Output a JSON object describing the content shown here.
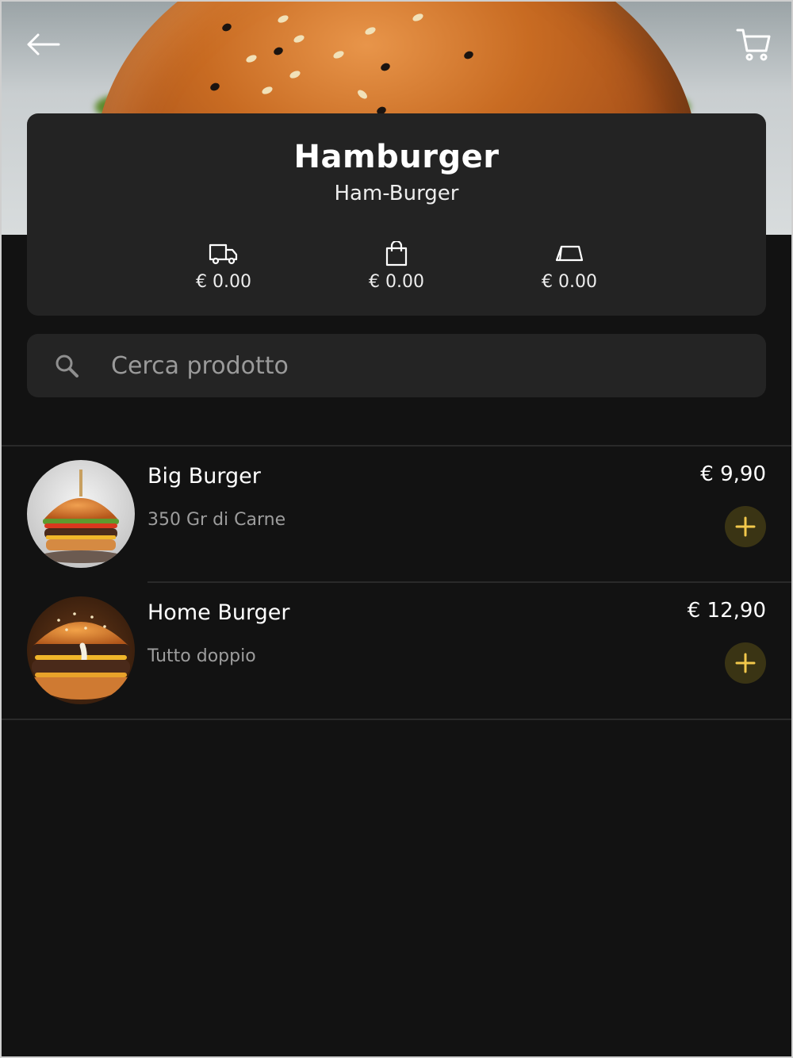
{
  "header": {
    "title": "Hamburger",
    "subtitle": "Ham-Burger"
  },
  "fees": [
    {
      "icon": "delivery-truck-icon",
      "value": "€ 0.00"
    },
    {
      "icon": "shopping-bag-icon",
      "value": "€ 0.00"
    },
    {
      "icon": "service-tray-icon",
      "value": "€ 0.00"
    }
  ],
  "search": {
    "placeholder": "Cerca prodotto",
    "value": ""
  },
  "products": [
    {
      "name": "Big Burger",
      "description": "350 Gr di Carne",
      "price": "€ 9,90"
    },
    {
      "name": "Home Burger",
      "description": "Tutto doppio",
      "price": "€ 12,90"
    }
  ],
  "colors": {
    "background": "#121212",
    "card": "#232323",
    "accent": "#f2c84b",
    "add_button_bg": "#3a3414"
  }
}
